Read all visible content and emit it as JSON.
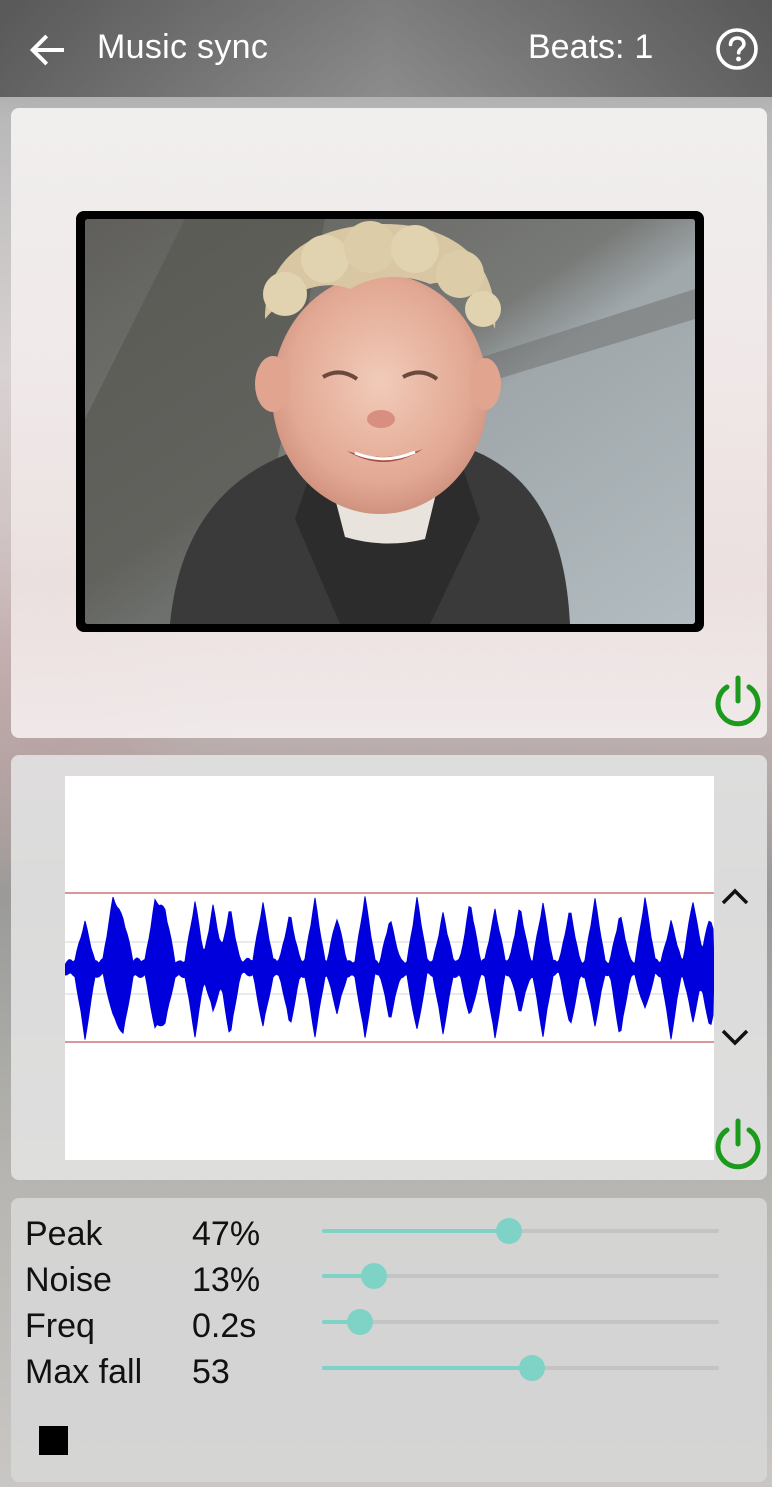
{
  "app_bar": {
    "title": "Music sync",
    "beats_label": "Beats:",
    "beats_count": "1",
    "back_icon": "arrow-left-icon",
    "help_icon": "help-circle-icon"
  },
  "photo_panel": {
    "power_icon": "power-icon",
    "power_color": "#1c9a1c"
  },
  "waveform_panel": {
    "up_icon": "chevron-up-icon",
    "down_icon": "chevron-down-icon",
    "power_icon": "power-icon",
    "wave_color": "#0000dd",
    "threshold_color": "#b03030"
  },
  "controls": [
    {
      "label": "Peak",
      "value": "47%",
      "level": 0.47
    },
    {
      "label": "Noise",
      "value": "13%",
      "level": 0.13
    },
    {
      "label": "Freq",
      "value": "0.2s",
      "level": 0.095
    },
    {
      "label": "Max fall",
      "value": "53",
      "level": 0.53
    }
  ],
  "stop_icon": "stop-icon",
  "accent_color": "#7fd3c6"
}
